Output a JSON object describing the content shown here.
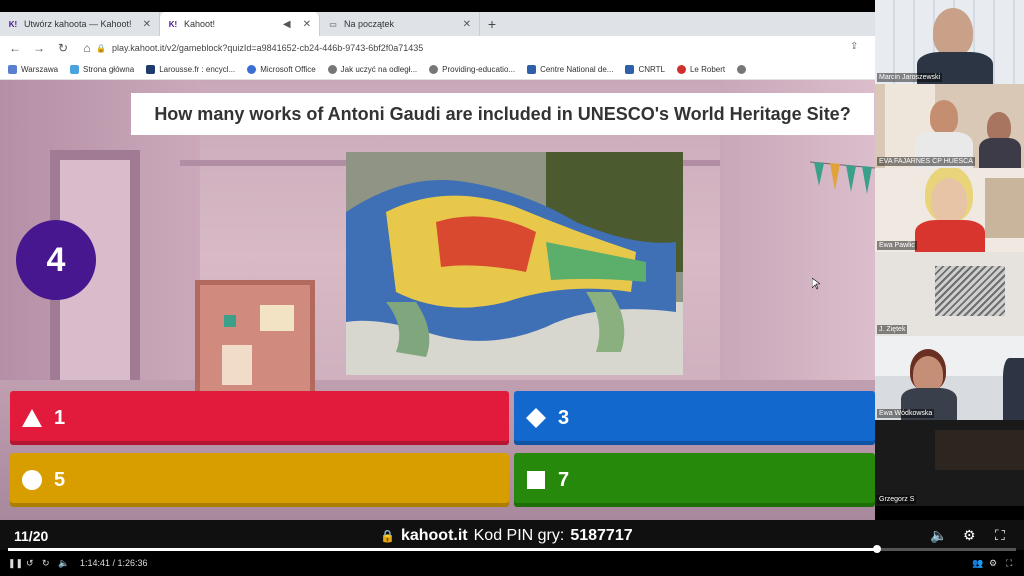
{
  "browser": {
    "tabs": [
      {
        "favicon": "K!",
        "title": "Utwórz kahoota — Kahoot!"
      },
      {
        "favicon": "K!",
        "title": "Kahoot!"
      },
      {
        "favicon": "",
        "title": "Na początek"
      }
    ],
    "url": "play.kahoot.it/v2/gameblock?quizId=a9841652-cb24-446b-9743-6bf2f0a71435",
    "bookmarks": [
      "Warszawa",
      "Strona główna",
      "Larousse.fr : encycl...",
      "Microsoft Office",
      "Jak uczyć na odległ...",
      "Providing-educatio...",
      "Centre National de...",
      "CNRTL",
      "Le Robert"
    ]
  },
  "game": {
    "question": "How many works of Antoni Gaudi are included in UNESCO's World Heritage Site?",
    "timer": "4",
    "answers": [
      {
        "label": "1",
        "shape": "triangle-icon",
        "color": "#e21b3c"
      },
      {
        "label": "3",
        "shape": "diamond-icon",
        "color": "#1368ce"
      },
      {
        "label": "5",
        "shape": "circle-icon",
        "color": "#d89e00"
      },
      {
        "label": "7",
        "shape": "square-icon",
        "color": "#26890c"
      }
    ],
    "question_counter": "11/20",
    "site": "kahoot.it",
    "pin_label": "Kod PIN gry:",
    "pin": "5187717"
  },
  "player": {
    "time_current": "1:14:41",
    "time_total": "1:26:36",
    "time_display": "1:14:41 / 1:26:36",
    "progress": 0.862
  },
  "participants": [
    {
      "name": "Marcin Jaroszewski"
    },
    {
      "name": "EVA FAJARNES CP HUESCA"
    },
    {
      "name": "Ewa Pawlic"
    },
    {
      "name": "J. Ziętek"
    },
    {
      "name": "Ewa Wódkowska"
    },
    {
      "name": "Grzegorz S"
    }
  ]
}
